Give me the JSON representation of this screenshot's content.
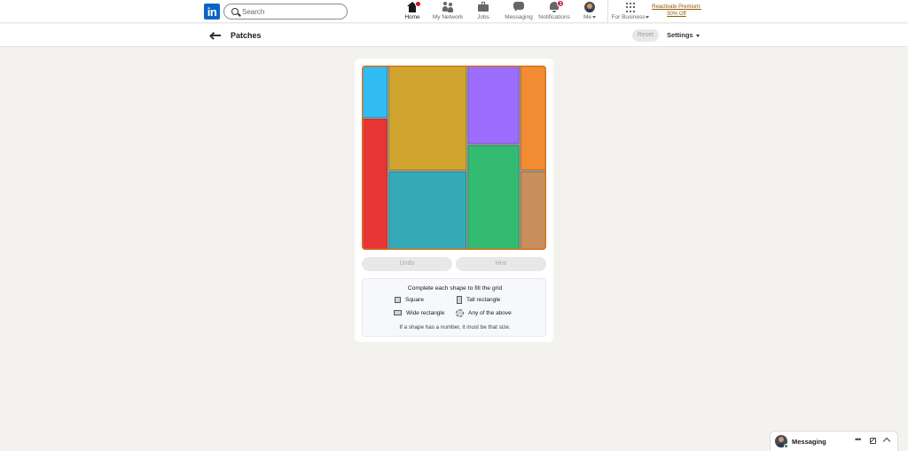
{
  "nav": {
    "logo": "in",
    "search_placeholder": "Search",
    "items": [
      {
        "label": "Home",
        "icon": "home-icon",
        "active": true
      },
      {
        "label": "My Network",
        "icon": "network-icon"
      },
      {
        "label": "Jobs",
        "icon": "jobs-icon"
      },
      {
        "label": "Messaging",
        "icon": "messaging-icon"
      },
      {
        "label": "Notifications",
        "icon": "bell-icon",
        "badge": "3"
      },
      {
        "label": "Me",
        "icon": "avatar-icon"
      },
      {
        "label": "For Business",
        "icon": "grid-icon"
      }
    ],
    "premium_line1": "Reactivate Premium:",
    "premium_line2": "50% Off"
  },
  "header": {
    "title": "Patches",
    "reset_label": "Reset",
    "settings_label": "Settings"
  },
  "board": {
    "cols": 7,
    "rows": 7,
    "border_color": "#d4731f",
    "pieces": [
      {
        "color": "#31bcf4",
        "col": 0,
        "row": 0,
        "w": 1,
        "h": 2
      },
      {
        "color": "#cfa530",
        "col": 1,
        "row": 0,
        "w": 3,
        "h": 4
      },
      {
        "color": "#9d6dfd",
        "col": 4,
        "row": 0,
        "w": 2,
        "h": 3
      },
      {
        "color": "#f28c32",
        "col": 6,
        "row": 0,
        "w": 1,
        "h": 4
      },
      {
        "color": "#e83535",
        "col": 0,
        "row": 2,
        "w": 1,
        "h": 5
      },
      {
        "color": "#34aab8",
        "col": 1,
        "row": 4,
        "w": 3,
        "h": 3
      },
      {
        "color": "#34bb72",
        "col": 4,
        "row": 3,
        "w": 2,
        "h": 4
      },
      {
        "color": "#c88f5d",
        "col": 6,
        "row": 4,
        "w": 1,
        "h": 3
      }
    ]
  },
  "controls": {
    "undo_label": "Undo",
    "hint_label": "Hint"
  },
  "legend": {
    "title": "Complete each shape to fill the grid",
    "square": "Square",
    "tall": "Tall rectangle",
    "wide": "Wide rectangle",
    "any": "Any of the above",
    "note": "If a shape has a number, it must be that size."
  },
  "messaging": {
    "label": "Messaging"
  }
}
